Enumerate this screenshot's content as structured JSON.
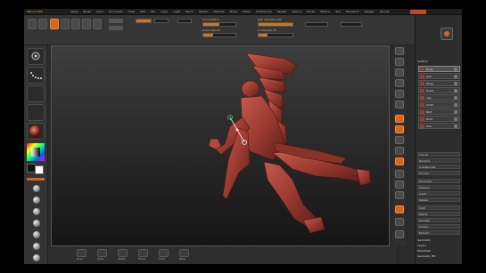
{
  "menubar": {
    "title": "ZBrush 4R6",
    "items": [
      "Alpha",
      "Brush",
      "Color",
      "Document",
      "Draw",
      "Edit",
      "File",
      "Layer",
      "Light",
      "Macro",
      "Marker",
      "Material",
      "Movie",
      "Picker",
      "Preferences",
      "Render",
      "Stencil",
      "Stroke",
      "Texture",
      "Tool",
      "Transform",
      "Zplugin",
      "Zscript"
    ]
  },
  "topbar": {
    "labels": {
      "focal": "Focal Shift 0",
      "draw": "Draw Size 64",
      "rgb": "Rgb Intensity 100",
      "z": "Z Intensity 25"
    }
  },
  "bottombar": {
    "buttons": [
      "Move",
      "Scale",
      "Rotate",
      "Frame",
      "Local",
      "Persp"
    ]
  },
  "rightpanel": {
    "header": "SubTool",
    "subtools": [
      "Body",
      "Arm",
      "Wing",
      "Head",
      "Leg",
      "Cloth",
      "Belt",
      "Boot",
      "Hair"
    ],
    "rows": [
      "List All",
      "Rename",
      "AutoReorder",
      "All Low",
      "Duplicate",
      "Append",
      "Insert",
      "Delete",
      "Split",
      "Merge",
      "Remesh",
      "Project",
      "Extract"
    ],
    "sections": [
      "Geometry",
      "Layers",
      "FiberMesh",
      "Geometry HD"
    ]
  },
  "colors": {
    "accent": "#d9631f",
    "figure": "#9a3a30"
  }
}
